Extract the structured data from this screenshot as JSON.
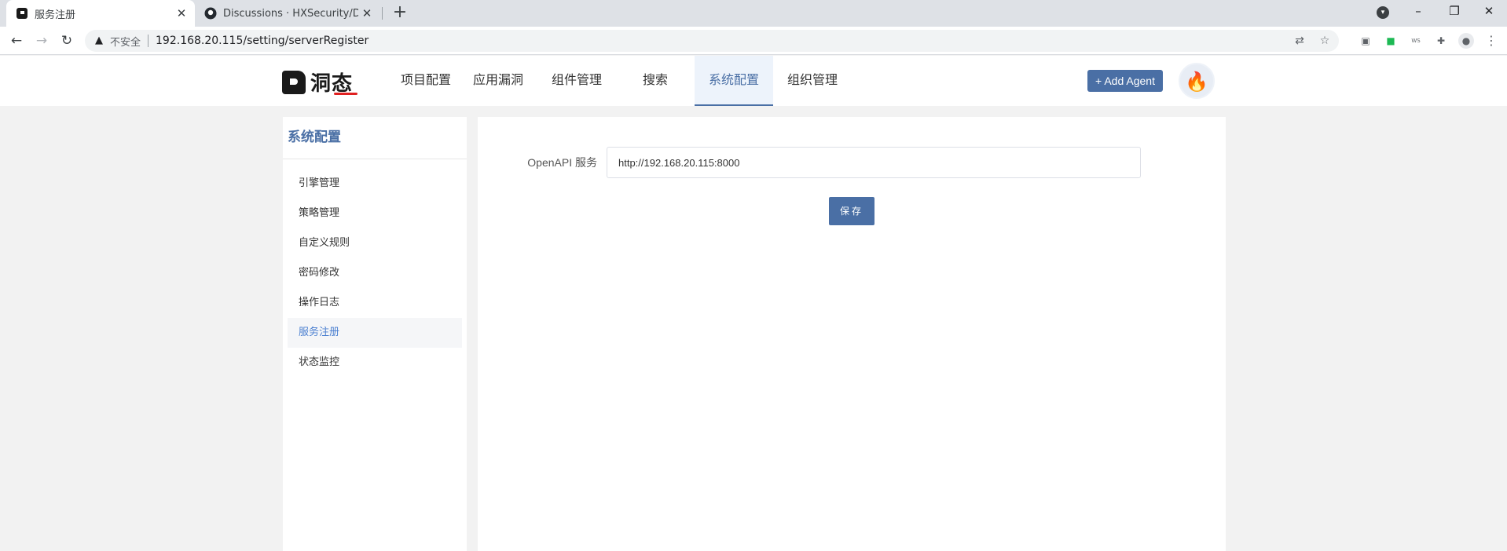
{
  "browser": {
    "tabs": [
      {
        "title": "服务注册",
        "active": true
      },
      {
        "title": "Discussions · HXSecurity/Dong",
        "active": false
      }
    ],
    "new_tab": "+",
    "close_glyph": "✕",
    "security_label": "不安全",
    "url": "192.168.20.115/setting/serverRegister",
    "window_controls": [
      "–",
      "❐",
      "✕"
    ]
  },
  "app": {
    "logo_text": "洞态",
    "nav": [
      {
        "label": "项目配置"
      },
      {
        "label": "应用漏洞"
      },
      {
        "label": "组件管理"
      },
      {
        "label": "搜索"
      },
      {
        "label": "系统配置",
        "active": true
      },
      {
        "label": "组织管理"
      }
    ],
    "add_agent_label": "+ Add Agent"
  },
  "sidebar": {
    "title": "系统配置",
    "items": [
      {
        "label": "引擎管理"
      },
      {
        "label": "策略管理"
      },
      {
        "label": "自定义规则"
      },
      {
        "label": "密码修改"
      },
      {
        "label": "操作日志"
      },
      {
        "label": "服务注册",
        "active": true
      },
      {
        "label": "状态监控"
      }
    ]
  },
  "form": {
    "openapi_label": "OpenAPI 服务",
    "openapi_value": "http://192.168.20.115:8000",
    "save_label": "保存"
  },
  "colors": {
    "accent": "#4a6fa5",
    "active_link": "#4a7fd0",
    "page_bg": "#f2f2f2"
  }
}
